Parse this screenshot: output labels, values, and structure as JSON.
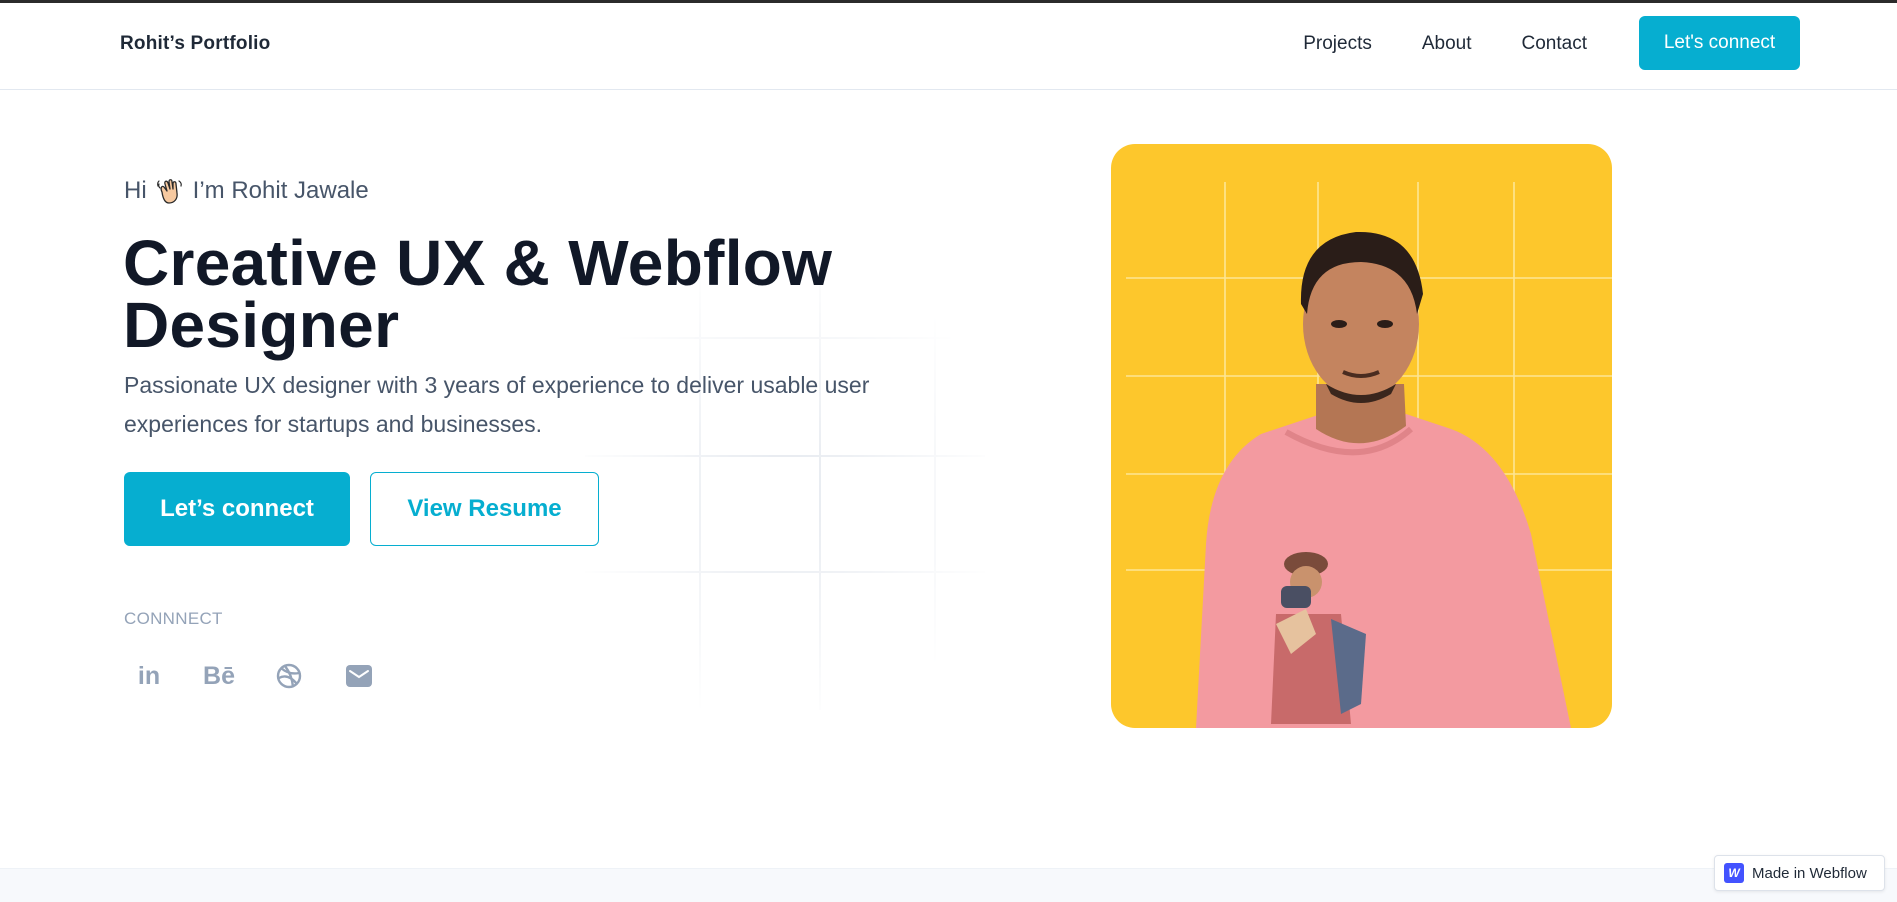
{
  "nav": {
    "brand": "Rohit’s  Portfolio",
    "links": [
      "Projects",
      "About",
      "Contact"
    ],
    "cta": "Let's connect"
  },
  "hero": {
    "greeting_prefix": "Hi",
    "greeting_icon": "waving-hand-icon",
    "greeting_name": "I’m Rohit Jawale",
    "headline_line1": "Creative UX & Webflow",
    "headline_line2": "Designer",
    "subtitle": "Passionate UX designer with 3 years of experience to deliver usable user experiences for startups and businesses.",
    "primary_button": "Let’s connect",
    "secondary_button": "View Resume",
    "connect_label": "CONNNECT",
    "socials": [
      {
        "name": "linkedin-icon",
        "text": "in"
      },
      {
        "name": "behance-icon",
        "text": "Bē"
      },
      {
        "name": "dribbble-icon"
      },
      {
        "name": "mail-icon"
      }
    ]
  },
  "photo": {
    "background_color": "#fdc72c",
    "subject": "portrait-photo"
  },
  "badge": {
    "logo_letter": "W",
    "label": "Made in Webflow"
  },
  "colors": {
    "accent": "#06aed0",
    "heading": "#111827",
    "muted": "#94a3b8"
  }
}
